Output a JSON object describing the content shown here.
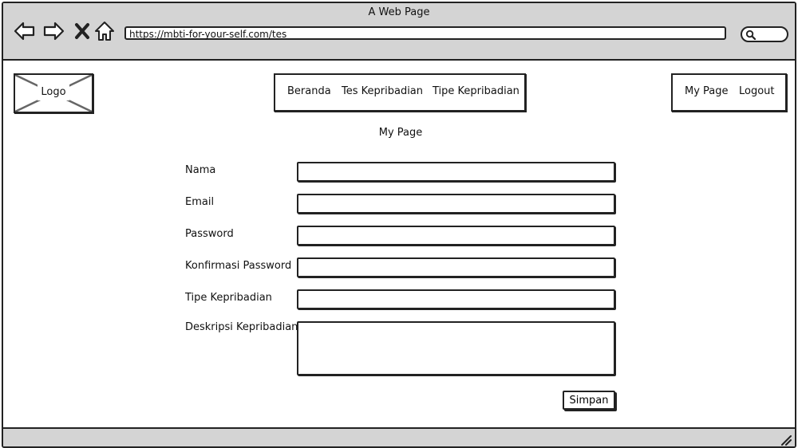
{
  "window": {
    "title": "A Web Page"
  },
  "browser": {
    "url": "https://mbti-for-your-self.com/tes",
    "icons": [
      "back-arrow-icon",
      "forward-arrow-icon",
      "close-x-icon",
      "home-icon",
      "search-icon",
      "resize-grip-icon"
    ]
  },
  "header": {
    "logo_label": "Logo",
    "main_nav": [
      {
        "label": "Beranda"
      },
      {
        "label": "Tes Kepribadian"
      },
      {
        "label": "Tipe Kepribadian"
      }
    ],
    "user_nav": [
      {
        "label": "My Page"
      },
      {
        "label": "Logout"
      }
    ]
  },
  "page": {
    "title": "My Page"
  },
  "form": {
    "fields": [
      {
        "label": "Nama",
        "value": ""
      },
      {
        "label": "Email",
        "value": ""
      },
      {
        "label": "Password",
        "value": ""
      },
      {
        "label": "Konfirmasi Password",
        "value": ""
      },
      {
        "label": "Tipe Kepribadian",
        "value": ""
      },
      {
        "label": "Deskripsi Kepribadian",
        "value": ""
      }
    ],
    "submit_label": "Simpan"
  },
  "colors": {
    "chrome": "#d4d4d4",
    "stroke": "#222222",
    "background": "#ffffff"
  }
}
